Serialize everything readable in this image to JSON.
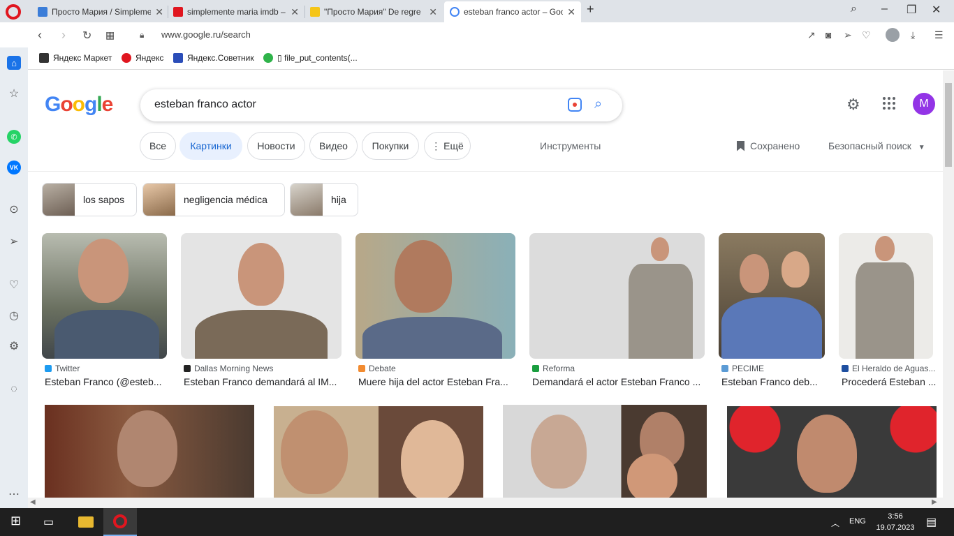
{
  "browser": {
    "tabs": [
      {
        "title": "Просто Мария / Simpleme",
        "fav_color": "#3b7dd8",
        "active": false
      },
      {
        "title": "simplemente maria imdb –",
        "fav_color": "#e0161f",
        "active": false
      },
      {
        "title": "\"Просто Мария\" De regre",
        "fav_color": "#f5c518",
        "active": false
      },
      {
        "title": "esteban franco actor – Goo",
        "fav_color": "#4285f4",
        "active": true
      }
    ],
    "new_tab": "+",
    "url": "www.google.ru/search",
    "bookmarks": [
      {
        "label": "Яндекс Маркет",
        "color": "#333"
      },
      {
        "label": "Яндекс",
        "color": "#e0161f"
      },
      {
        "label": "Яндекс.Советник",
        "color": "#2b4db8"
      },
      {
        "label": "▯ file_put_contents(...",
        "color": "#2fb34a"
      }
    ]
  },
  "search": {
    "logo": "Google",
    "query": "esteban franco actor",
    "avatar_letter": "M"
  },
  "filters": {
    "items": [
      "Все",
      "Картинки",
      "Новости",
      "Видео",
      "Покупки",
      "⋮ Ещё"
    ],
    "active": "Картинки",
    "tools": "Инструменты",
    "saved": "Сохранено",
    "safe_search": "Безопасный поиск"
  },
  "related": [
    {
      "label": "los sapos"
    },
    {
      "label": "negligencia médica"
    },
    {
      "label": "hija"
    }
  ],
  "results": [
    {
      "source": "Twitter",
      "source_color": "#1d9bf0",
      "caption": "Esteban Franco (@esteb..."
    },
    {
      "source": "Dallas Morning News",
      "source_color": "#222",
      "caption": "Esteban Franco demandará al IM..."
    },
    {
      "source": "Debate",
      "source_color": "#f28b30",
      "caption": "Muere hija del actor Esteban Fra..."
    },
    {
      "source": "Reforma",
      "source_color": "#1a9e3f",
      "caption": "Demandará el actor Esteban Franco ..."
    },
    {
      "source": "PECIME",
      "source_color": "#5b9bd5",
      "caption": "Esteban Franco deb..."
    },
    {
      "source": "El Heraldo de Aguas...",
      "source_color": "#1e4fa0",
      "caption": "Procederá Esteban ..."
    }
  ],
  "taskbar": {
    "lang": "ENG",
    "time": "3:56",
    "date": "19.07.2023"
  }
}
